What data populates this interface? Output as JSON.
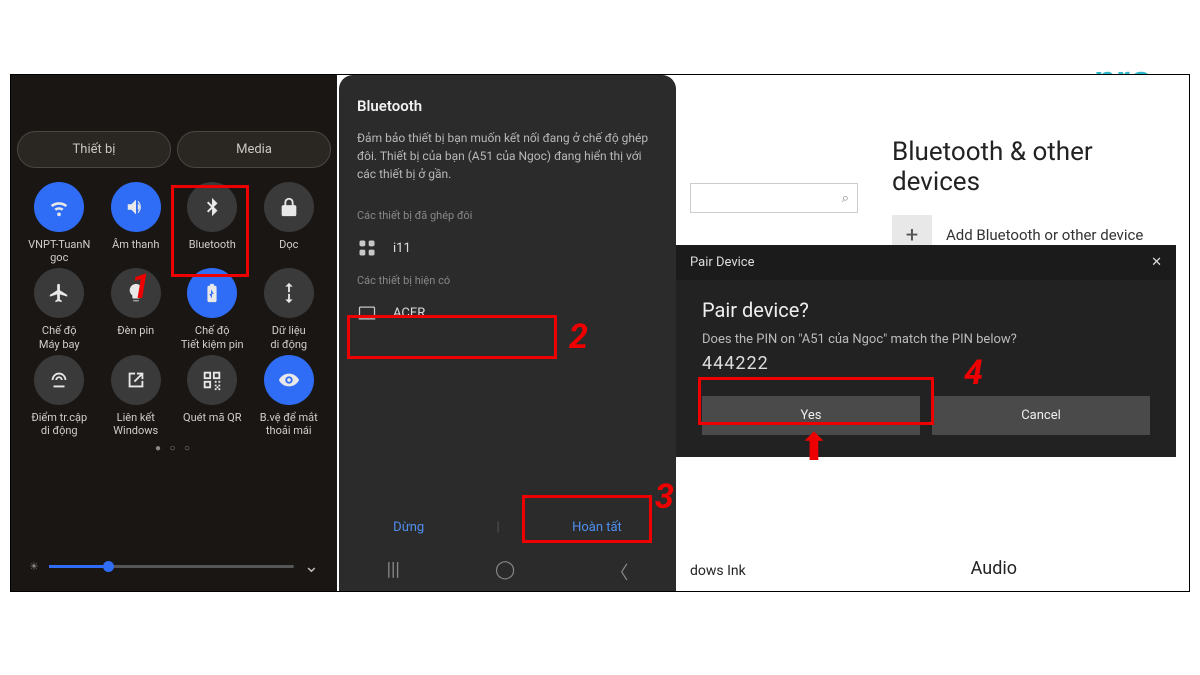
{
  "logo": "pro",
  "panel1": {
    "tabs": [
      "Thiết bị",
      "Media"
    ],
    "tiles": [
      {
        "label": "VNPT-TuanN\ngoc",
        "on": true,
        "icon": "wifi"
      },
      {
        "label": "Âm thanh",
        "on": true,
        "icon": "sound"
      },
      {
        "label": "Bluetooth",
        "on": false,
        "icon": "bluetooth"
      },
      {
        "label": "Dọc",
        "on": false,
        "icon": "lock"
      },
      {
        "label": "Chế độ\nMáy bay",
        "on": false,
        "icon": "plane"
      },
      {
        "label": "Đèn pin",
        "on": false,
        "icon": "flash"
      },
      {
        "label": "Chế độ\nTiết kiệm pin",
        "on": true,
        "icon": "battery"
      },
      {
        "label": "Dữ liệu\ndi động",
        "on": false,
        "icon": "data"
      },
      {
        "label": "Điểm tr.cập\ndi động",
        "on": false,
        "icon": "hotspot"
      },
      {
        "label": "Liên kết\nWindows",
        "on": false,
        "icon": "link"
      },
      {
        "label": "Quét mã QR",
        "on": false,
        "icon": "qr"
      },
      {
        "label": "B.vệ để mắt\nthoải mái",
        "on": true,
        "icon": "eye"
      }
    ],
    "num": "1"
  },
  "panel2": {
    "title": "Bluetooth",
    "desc": "Đảm bảo thiết bị bạn muốn kết nối đang ở chế độ ghép đôi. Thiết bị của bạn (A51 của Ngoc) đang hiển thị với các thiết bị ở gần.",
    "paired_label": "Các thiết bị đã ghép đôi",
    "paired": "i11",
    "avail_label": "Các thiết bị hiện có",
    "avail": "ACER",
    "stop": "Dừng",
    "done": "Hoàn tất",
    "num2": "2",
    "num3": "3"
  },
  "panel3": {
    "title": "Bluetooth & other devices",
    "add": "Add Bluetooth or other device",
    "ink": "dows Ink",
    "audio": "Audio",
    "dialog": {
      "hdr": "Pair Device",
      "q": "Pair device?",
      "msg": "Does the PIN on \"A51 của Ngoc\" match the PIN below?",
      "pin": "444222",
      "yes": "Yes",
      "cancel": "Cancel"
    },
    "num4": "4"
  }
}
